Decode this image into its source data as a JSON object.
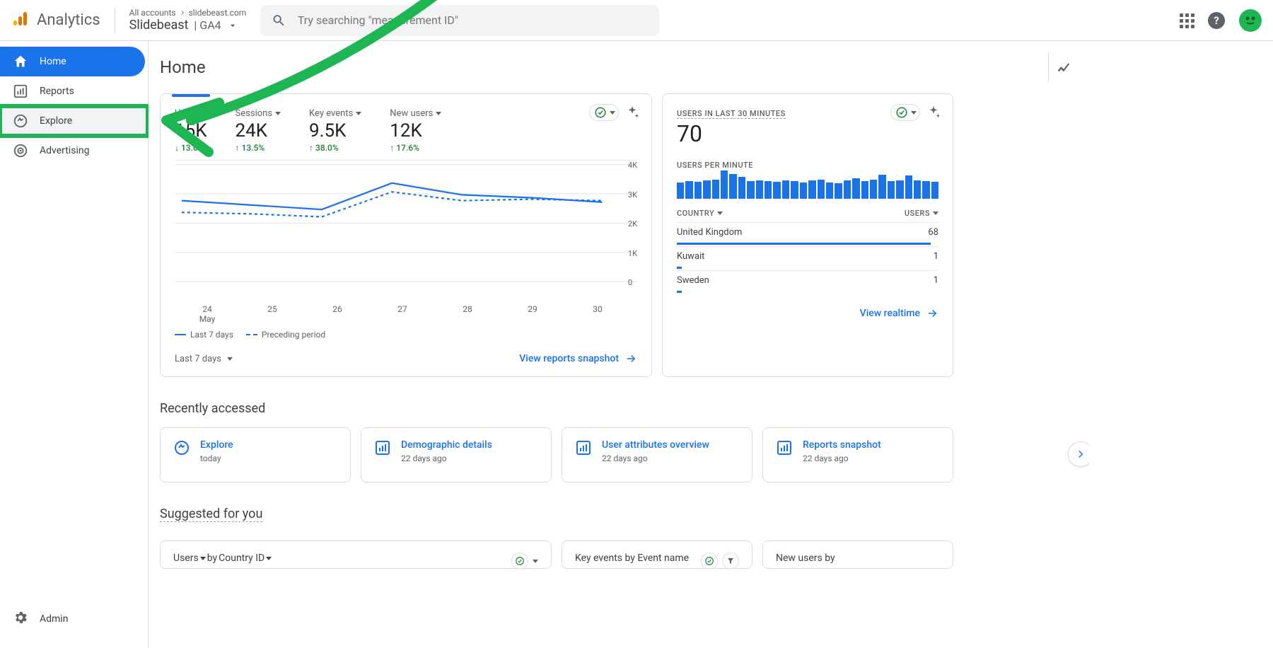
{
  "header": {
    "product": "Analytics",
    "breadcrumb_all": "All accounts",
    "breadcrumb_domain": "slidebeast.com",
    "property_name": "Slidebeast",
    "property_suffix": "| GA4",
    "search_placeholder": "Try searching \"measurement ID\""
  },
  "sidebar": {
    "items": [
      {
        "id": "home",
        "label": "Home",
        "active": true
      },
      {
        "id": "reports",
        "label": "Reports",
        "active": false
      },
      {
        "id": "explore",
        "label": "Explore",
        "active": false,
        "highlight": true
      },
      {
        "id": "advertising",
        "label": "Advertising",
        "active": false
      }
    ],
    "admin_label": "Admin"
  },
  "page_title": "Home",
  "overview": {
    "metrics": [
      {
        "label": "Users",
        "value": "15K",
        "change": "↓ 13.0%"
      },
      {
        "label": "Sessions",
        "value": "24K",
        "change": "↑ 13.5%"
      },
      {
        "label": "Key events",
        "value": "9.5K",
        "change": "↑ 38.0%"
      },
      {
        "label": "New users",
        "value": "12K",
        "change": "↑ 17.6%"
      }
    ],
    "date_range_label": "Last 7 days",
    "legend_current": "Last 7 days",
    "legend_previous": "Preceding period",
    "link_text": "View reports snapshot"
  },
  "realtime": {
    "header_label": "USERS IN LAST 30 MINUTES",
    "value": "70",
    "per_minute_label": "USERS PER MINUTE",
    "table_head_left": "COUNTRY",
    "table_head_right": "USERS",
    "rows": [
      {
        "country": "United Kingdom",
        "users": "68"
      },
      {
        "country": "Kuwait",
        "users": "1"
      },
      {
        "country": "Sweden",
        "users": "1"
      }
    ],
    "link_text": "View realtime"
  },
  "recently_accessed": {
    "title": "Recently accessed",
    "items": [
      {
        "title": "Explore",
        "time": "today",
        "icon": "explore"
      },
      {
        "title": "Demographic details",
        "time": "22 days ago",
        "icon": "bar"
      },
      {
        "title": "User attributes overview",
        "time": "22 days ago",
        "icon": "bar"
      },
      {
        "title": "Reports snapshot",
        "time": "22 days ago",
        "icon": "bar"
      }
    ]
  },
  "suggested": {
    "title": "Suggested for you",
    "cards": [
      {
        "title_parts": [
          "Users",
          " by ",
          "Country ID"
        ]
      },
      {
        "title_plain": "Key events by Event name"
      },
      {
        "title_plain": "New users by"
      }
    ]
  },
  "chart_data": {
    "type": "line",
    "x_labels": [
      "24\nMay",
      "25",
      "26",
      "27",
      "28",
      "29",
      "30"
    ],
    "ylim": [
      0,
      4000
    ],
    "y_ticks": [
      "4K",
      "3K",
      "2K",
      "1K",
      "0"
    ],
    "series": [
      {
        "name": "Last 7 days",
        "style": "solid",
        "values": [
          2900,
          2750,
          2600,
          3500,
          3100,
          3000,
          2850
        ]
      },
      {
        "name": "Preceding period",
        "style": "dashed",
        "values": [
          2500,
          2450,
          2350,
          3200,
          2900,
          2950,
          2900
        ]
      }
    ]
  },
  "realtime_bars": {
    "values": [
      20,
      22,
      21,
      23,
      24,
      35,
      31,
      27,
      22,
      23,
      22,
      21,
      23,
      22,
      20,
      23,
      24,
      20,
      19,
      23,
      25,
      22,
      24,
      30,
      22,
      23,
      29,
      23,
      22,
      21
    ]
  }
}
